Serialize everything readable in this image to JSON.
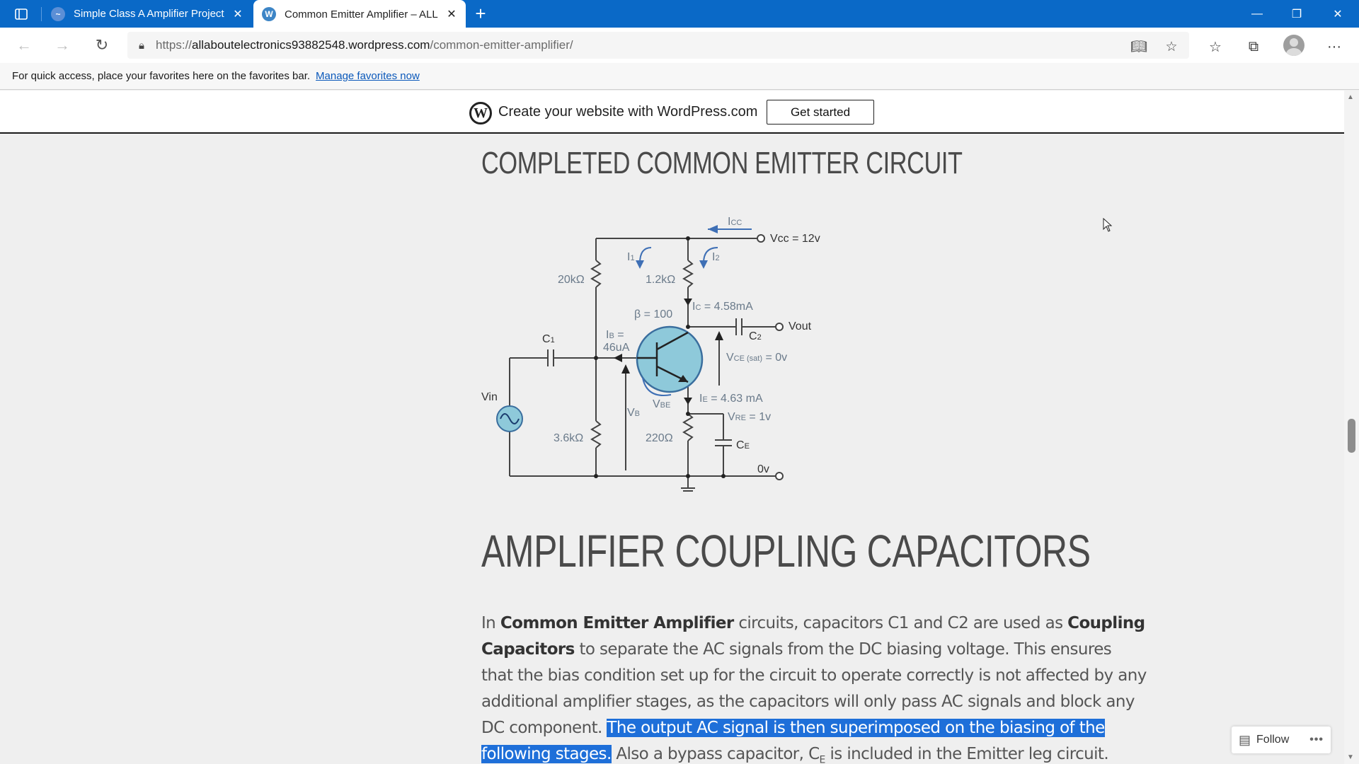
{
  "tabs": [
    {
      "title": "Simple Class A Amplifier Project",
      "active": false
    },
    {
      "title": "Common Emitter Amplifier – ALL",
      "active": true
    }
  ],
  "url": {
    "prefix": "https://",
    "host": "allaboutelectronics93882548.wordpress.com",
    "path": "/common-emitter-amplifier/"
  },
  "favorites_bar": {
    "message": "For quick access, place your favorites here on the favorites bar.",
    "link": "Manage favorites now"
  },
  "wp_banner": {
    "text": "Create your website with WordPress.com",
    "button": "Get started"
  },
  "headings": {
    "completed": "COMPLETED COMMON EMITTER CIRCUIT",
    "coupling": "AMPLIFIER COUPLING CAPACITORS"
  },
  "circuit": {
    "icc": "I",
    "icc_sub": "CC",
    "vcc": "Vcc = 12v",
    "i1": "I",
    "i1_sub": "1",
    "i2": "I",
    "i2_sub": "2",
    "r1": "20kΩ",
    "rc": "1.2kΩ",
    "beta": "β = 100",
    "ic": "I",
    "ic_sub": "C",
    "ic_val": " = 4.58mA",
    "c1": "C",
    "c1_sub": "1",
    "ib": "I",
    "ib_sub": "B",
    "ib_eq": " =",
    "ib_val": "46uA",
    "c2": "C",
    "c2_sub": "2",
    "vout": "Vout",
    "vce": "V",
    "vce_sub": "CE (sat)",
    "vce_val": " = 0v",
    "vin": "Vin",
    "vbe": "V",
    "vbe_sub": "BE",
    "vb": "V",
    "vb_sub": "B",
    "ie": "I",
    "ie_sub": "E",
    "ie_val": " = 4.63 mA",
    "vre": "V",
    "vre_sub": "RE",
    "vre_val": " = 1v",
    "r2": "3.6kΩ",
    "re": "220Ω",
    "ce": "C",
    "ce_sub": "E",
    "zero": "0v"
  },
  "paragraph": {
    "p1": "In ",
    "b1": "Common Emitter Amplifier",
    "p2": " circuits, capacitors C1 and C2 are used as ",
    "b2": "Coupling Capacitors",
    "p3": " to separate the AC signals from the DC biasing voltage. This ensures that the bias condition set up for the circuit to operate correctly is not affected by any additional amplifier stages, as the capacitors will only pass AC signals and block any DC component. ",
    "highlight": "The output AC signal is then superimposed on the biasing of the following stages.",
    "p4": " Also a bypass capacitor, C",
    "sub": "E",
    "p5": " is included in the Emitter leg circuit."
  },
  "follow": {
    "label": "Follow",
    "more": "•••"
  },
  "colors": {
    "titlebar": "#0a69c7",
    "highlight": "#1e6fd9",
    "circuit_blue": "#4a78b8",
    "transistor_fill": "#8ec9da"
  }
}
